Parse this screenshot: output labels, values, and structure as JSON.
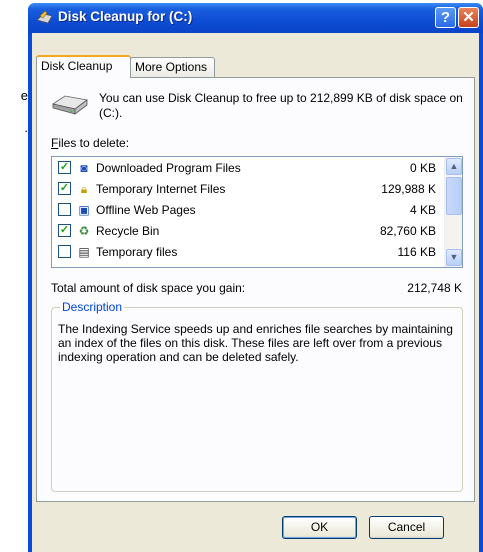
{
  "background": {
    "line1": "e",
    "line2": "."
  },
  "window": {
    "title": "Disk Cleanup for  (C:)",
    "help_label": "?",
    "close_label": "✕"
  },
  "tabs": [
    {
      "label": "Disk Cleanup",
      "active": true
    },
    {
      "label": "More Options",
      "active": false
    }
  ],
  "panel": {
    "intro": "You can use Disk Cleanup to free up to 212,899 KB of disk space on  (C:).",
    "files_label_rest": "iles to delete:",
    "files_label_hotkey": "F",
    "files": [
      {
        "checked": true,
        "icon": "downloaded-program-files-icon",
        "name": "Downloaded Program Files",
        "size": "0 KB"
      },
      {
        "checked": true,
        "icon": "temporary-internet-files-icon",
        "name": "Temporary Internet Files",
        "size": "129,988 K"
      },
      {
        "checked": false,
        "icon": "offline-web-pages-icon",
        "name": "Offline Web Pages",
        "size": "4 KB"
      },
      {
        "checked": true,
        "icon": "recycle-bin-icon",
        "name": "Recycle Bin",
        "size": "82,760 KB"
      },
      {
        "checked": false,
        "icon": "temporary-files-icon",
        "name": "Temporary files",
        "size": "116 KB"
      }
    ],
    "total_label": "Total amount of disk space you gain:",
    "total_value": "212,748 K",
    "description_title": "Description",
    "description_text": "The Indexing Service speeds up and enriches file searches by maintaining an index of the files on this disk. These files are left over from a previous indexing operation and can be deleted safely."
  },
  "buttons": {
    "ok": "OK",
    "cancel": "Cancel"
  },
  "colors": {
    "title_bar": "#0a4ad8",
    "accent_tab": "#f5a623",
    "group_title": "#0046d5"
  }
}
